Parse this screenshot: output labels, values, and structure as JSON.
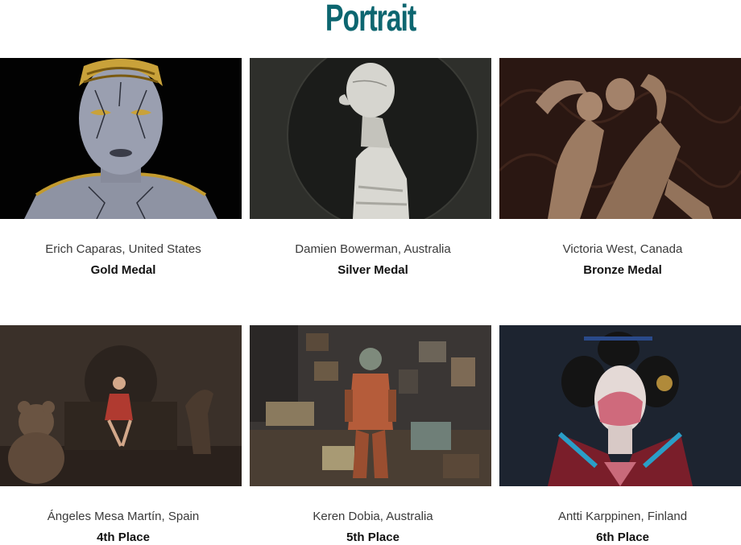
{
  "section": {
    "title": "Portrait",
    "title_color": "#0d6670"
  },
  "entries": [
    {
      "name": "Erich Caparas, United States",
      "award": "Gold Medal",
      "image": "painted-face-portrait"
    },
    {
      "name": "Damien Bowerman, Australia",
      "award": "Silver Medal",
      "image": "profile-bald-figure-portrait"
    },
    {
      "name": "Victoria West, Canada",
      "award": "Bronze Medal",
      "image": "embracing-figures-portrait"
    },
    {
      "name": "Ángeles Mesa Martín, Spain",
      "award": "4th Place",
      "image": "girl-in-red-dress-portrait"
    },
    {
      "name": "Keren Dobia, Australia",
      "award": "5th Place",
      "image": "cluttered-room-diver-portrait"
    },
    {
      "name": "Antti Karppinen, Finland",
      "award": "6th Place",
      "image": "geisha-portrait"
    }
  ]
}
